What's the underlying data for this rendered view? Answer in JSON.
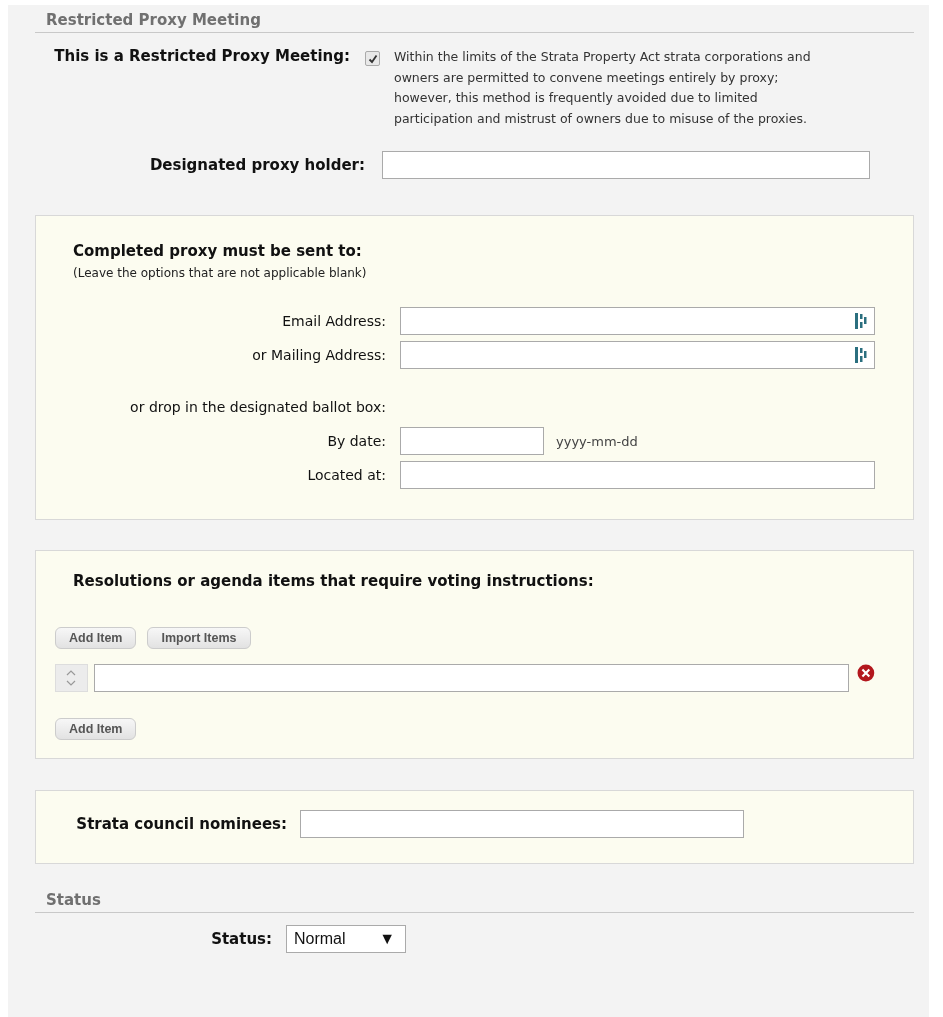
{
  "restricted_section": {
    "title": "Restricted Proxy Meeting",
    "restricted": {
      "label": "This is a Restricted Proxy Meeting:",
      "checked": true,
      "description": "Within the limits of the Strata Property Act strata corporations and owners are permitted to convene meetings entirely by proxy; however, this method is frequently avoided due to limited participation and mistrust of owners due to misuse of the proxies."
    },
    "proxy_holder": {
      "label": "Designated proxy holder:"
    }
  },
  "delivery_panel": {
    "title": "Completed proxy must be sent to:",
    "note": "(Leave the options that are not applicable blank)",
    "fields": [
      {
        "label": "Email Address:",
        "kind": "lookup"
      },
      {
        "label": "or Mailing Address:",
        "kind": "lookup"
      }
    ],
    "ballot_label": "or drop in the designated ballot box:",
    "ballot_fields": [
      {
        "label": "By date:",
        "kind": "date",
        "hint": "yyyy-mm-dd"
      },
      {
        "label": "Located at:",
        "kind": "text"
      }
    ]
  },
  "resolutions_panel": {
    "title": "Resolutions or agenda items that require voting instructions:",
    "top_buttons": [
      "Add Item",
      "Import Items"
    ],
    "items": [
      {
        "removable": true
      }
    ],
    "bottom_button": "Add Item"
  },
  "nominees_panel": {
    "label": "Strata council nominees:"
  },
  "status_section": {
    "title": "Status",
    "field": {
      "label": "Status:",
      "value": "Normal",
      "arrow": "▼"
    }
  }
}
